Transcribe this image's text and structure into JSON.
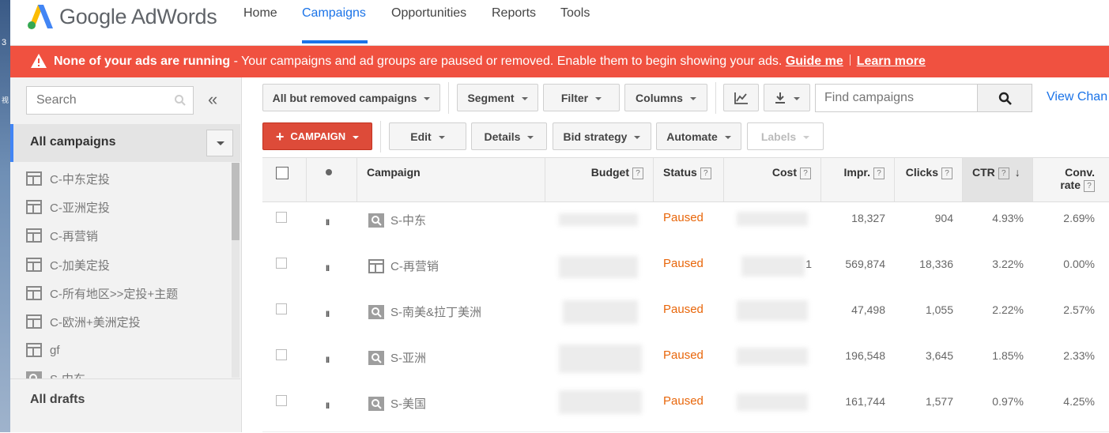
{
  "app": {
    "brand": "Google AdWords",
    "nav": [
      {
        "label": "Home",
        "active": false
      },
      {
        "label": "Campaigns",
        "active": true
      },
      {
        "label": "Opportunities",
        "active": false
      },
      {
        "label": "Reports",
        "active": false
      },
      {
        "label": "Tools",
        "active": false
      }
    ]
  },
  "alert": {
    "title": "None of your ads are running",
    "message": " - Your campaigns and ad groups are paused or removed. Enable them to begin showing your ads.",
    "guide_link": "Guide me",
    "learn_link": "Learn more",
    "color": "#f05140"
  },
  "sidebar": {
    "search_placeholder": "Search",
    "collapse_icon": "«",
    "all_campaigns": "All campaigns",
    "campaigns": [
      {
        "name": "C-中东定投",
        "icon": "display-icon"
      },
      {
        "name": "C-亚洲定投",
        "icon": "display-icon"
      },
      {
        "name": "C-再营销",
        "icon": "display-icon"
      },
      {
        "name": "C-加美定投",
        "icon": "display-icon"
      },
      {
        "name": "C-所有地区>>定投+主题",
        "icon": "display-icon"
      },
      {
        "name": "C-欧洲+美洲定投",
        "icon": "display-icon"
      },
      {
        "name": "gf",
        "icon": "display-icon"
      },
      {
        "name": "S-中东",
        "icon": "search-icon"
      }
    ],
    "all_drafts": "All drafts"
  },
  "toolbar": {
    "filter_scope": "All but removed campaigns",
    "segment": "Segment",
    "filter": "Filter",
    "columns": "Columns",
    "find_placeholder": "Find campaigns",
    "view_changes": "View Chan",
    "campaign_button": "CAMPAIGN",
    "edit": "Edit",
    "details": "Details",
    "bid_strategy": "Bid strategy",
    "automate": "Automate",
    "labels": "Labels"
  },
  "table": {
    "columns": {
      "campaign": "Campaign",
      "budget": "Budget",
      "status": "Status",
      "cost": "Cost",
      "impr": "Impr.",
      "clicks": "Clicks",
      "ctr": "CTR",
      "conv_rate_1": "Conv.",
      "conv_rate_2": "rate",
      "help": "?",
      "sort_arrow": "↓"
    },
    "rows": [
      {
        "name": "S-中东",
        "type": "search-icon",
        "status": "Paused",
        "cost_suffix": "",
        "impr": "18,327",
        "clicks": "904",
        "ctr": "4.93%",
        "conv_rate": "2.69%"
      },
      {
        "name": "C-再营销",
        "type": "display-icon",
        "status": "Paused",
        "cost_suffix": "1",
        "impr": "569,874",
        "clicks": "18,336",
        "ctr": "3.22%",
        "conv_rate": "0.00%"
      },
      {
        "name": "S-南美&拉丁美洲",
        "type": "search-icon",
        "status": "Paused",
        "cost_suffix": "",
        "impr": "47,498",
        "clicks": "1,055",
        "ctr": "2.22%",
        "conv_rate": "2.57%"
      },
      {
        "name": "S-亚洲",
        "type": "search-icon",
        "status": "Paused",
        "cost_suffix": "",
        "impr": "196,548",
        "clicks": "3,645",
        "ctr": "1.85%",
        "conv_rate": "2.33%"
      },
      {
        "name": "S-美国",
        "type": "search-icon",
        "status": "Paused",
        "cost_suffix": "",
        "impr": "161,744",
        "clicks": "1,577",
        "ctr": "0.97%",
        "conv_rate": "4.25%"
      }
    ]
  },
  "desktop": {
    "glyph_1": "3",
    "glyph_2": "视"
  }
}
